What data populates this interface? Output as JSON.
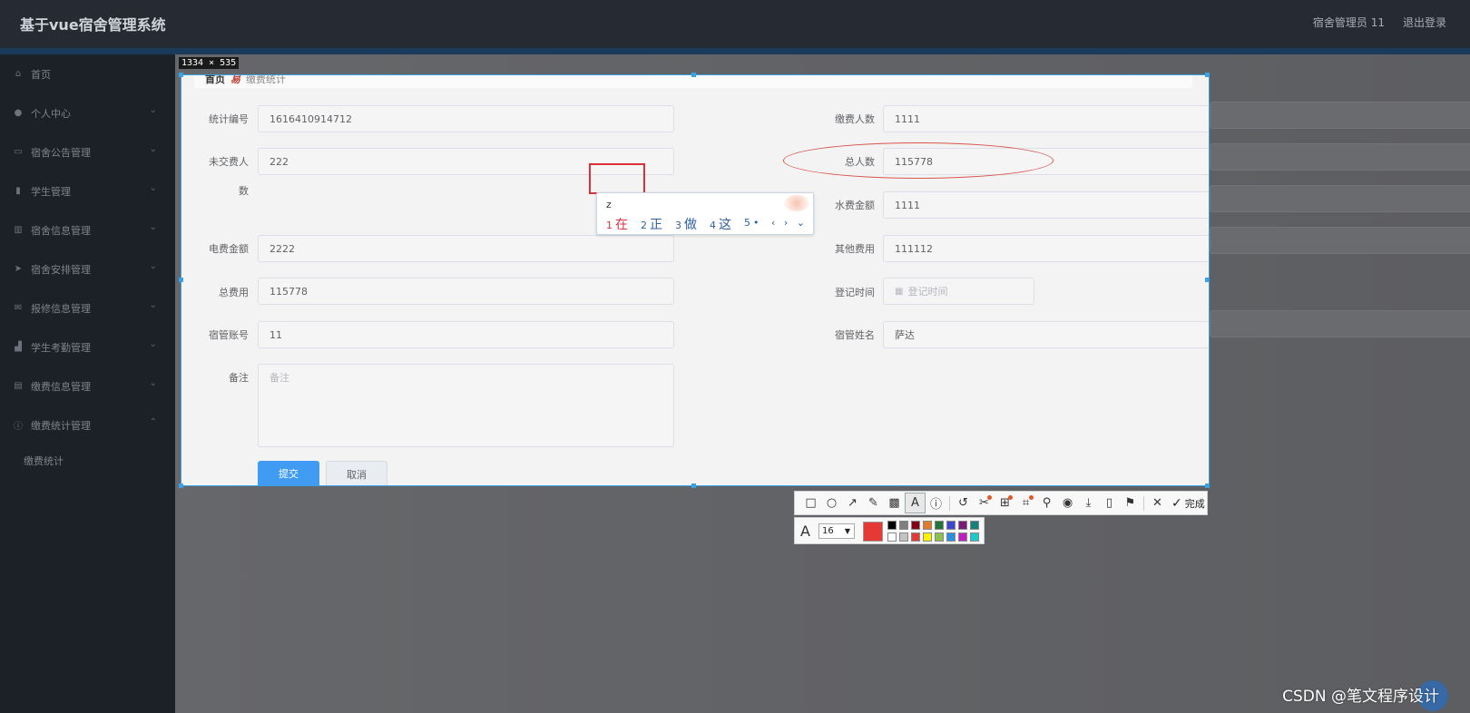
{
  "app": {
    "title": "基于vue宿舍管理系统"
  },
  "header": {
    "user_label": "宿舍管理员 11",
    "logout_label": "退出登录"
  },
  "sidebar": {
    "items": [
      {
        "label": "首页",
        "icon": "home-icon"
      },
      {
        "label": "个人中心",
        "icon": "user-icon"
      },
      {
        "label": "宿舍公告管理",
        "icon": "message-icon"
      },
      {
        "label": "学生管理",
        "icon": "chart-icon"
      },
      {
        "label": "宿舍信息管理",
        "icon": "trash-icon"
      },
      {
        "label": "宿舍安排管理",
        "icon": "send-icon"
      },
      {
        "label": "报修信息管理",
        "icon": "mail-icon"
      },
      {
        "label": "学生考勤管理",
        "icon": "stats-icon"
      },
      {
        "label": "缴费信息管理",
        "icon": "bank-icon"
      },
      {
        "label": "缴费统计管理",
        "icon": "info-icon"
      }
    ],
    "sub_item": "缴费统计"
  },
  "screenshot_tool": {
    "dimensions_label": "1334 × 535",
    "done_label": "完成",
    "font_size": "16",
    "current_color": "#e53935",
    "palette": [
      "#000000",
      "#7f7f7f",
      "#880015",
      "#e27b2b",
      "#22743a",
      "#3f48cc",
      "#7a1a7a",
      "#17807a",
      "#ffffff",
      "#c3c3c3",
      "#e53935",
      "#fff200",
      "#8bc34a",
      "#2f8fdf",
      "#c01fc0",
      "#1ec9c9"
    ]
  },
  "breadcrumb": {
    "home": "首页",
    "sep": "易",
    "current": "缴费统计"
  },
  "form": {
    "fields": {
      "stat_no": {
        "label": "统计编号",
        "value": "1616410914712"
      },
      "paid_count": {
        "label": "缴费人数",
        "value": "1111"
      },
      "unpaid_count": {
        "label": "未交费人",
        "label2": "数",
        "value": "222"
      },
      "total_people": {
        "label": "总人数",
        "value": "115778"
      },
      "water_fee": {
        "label": "水费金额",
        "value": "1111"
      },
      "electric_fee": {
        "label": "电费金额",
        "value": "2222"
      },
      "other_fee": {
        "label": "其他费用",
        "value": "111112"
      },
      "total_fee": {
        "label": "总费用",
        "value": "115778"
      },
      "register_time": {
        "label": "登记时间",
        "placeholder": "登记时间"
      },
      "manager_account": {
        "label": "宿管账号",
        "value": "11"
      },
      "manager_name": {
        "label": "宿管姓名",
        "value": "萨达"
      },
      "remark": {
        "label": "备注",
        "placeholder": "备注"
      }
    },
    "submit_label": "提交",
    "cancel_label": "取消"
  },
  "ime": {
    "input": "z",
    "candidates": [
      {
        "num": "1",
        "text": "在"
      },
      {
        "num": "2",
        "text": "正"
      },
      {
        "num": "3",
        "text": "做"
      },
      {
        "num": "4",
        "text": "这"
      },
      {
        "num": "5",
        "text": "•"
      }
    ],
    "nav": "‹ › ⌄"
  },
  "watermark": {
    "text": "CSDN @笔文程序设计"
  }
}
